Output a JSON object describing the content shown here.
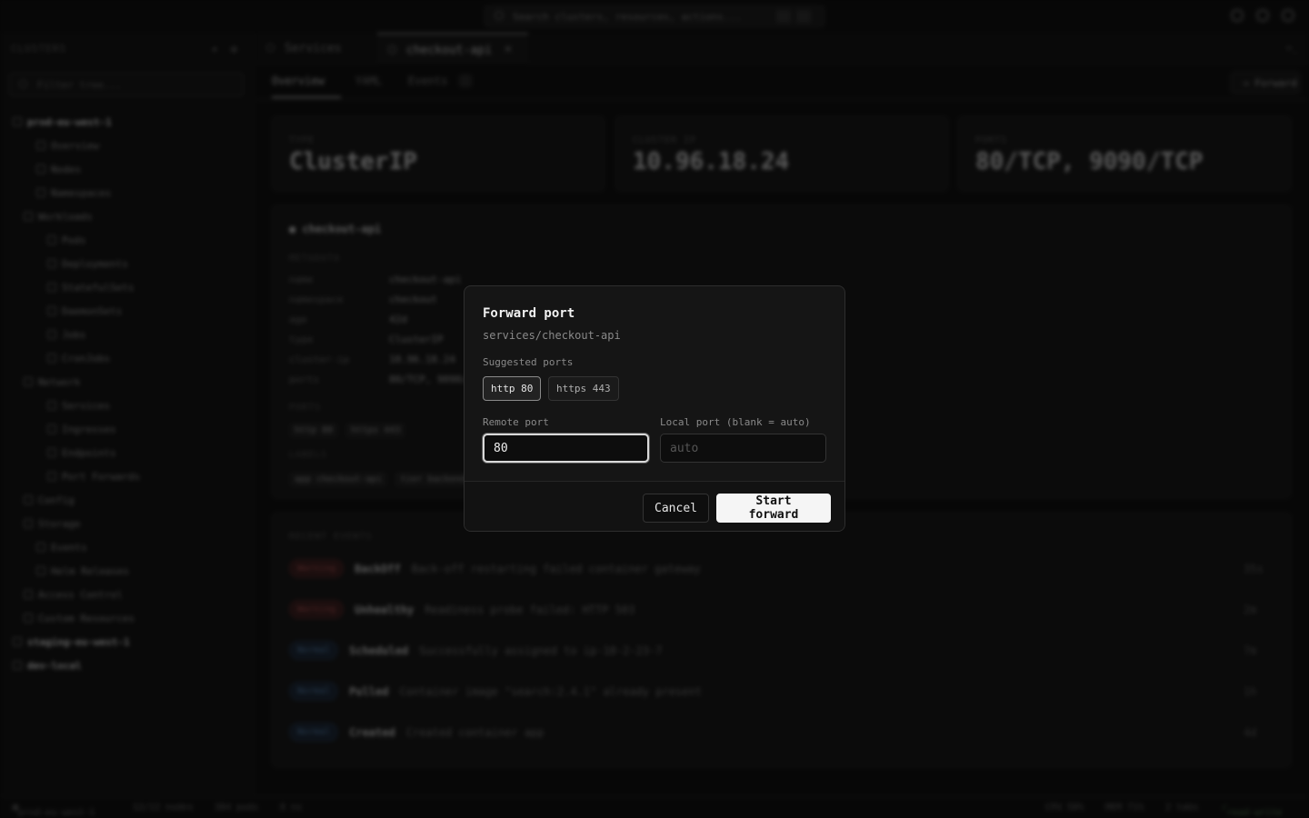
{
  "topbar": {
    "search_placeholder": "Search clusters, resources, actions..."
  },
  "sidebar": {
    "heading": "CLUSTERS",
    "filter_placeholder": "Filter tree...",
    "items": [
      {
        "label": "prod-eu-west-1",
        "level": 0,
        "bold": true
      },
      {
        "label": "Overview",
        "level": 2
      },
      {
        "label": "Nodes",
        "level": 2
      },
      {
        "label": "Namespaces",
        "level": 2
      },
      {
        "label": "Workloads",
        "level": 1
      },
      {
        "label": "Pods",
        "level": 3
      },
      {
        "label": "Deployments",
        "level": 3
      },
      {
        "label": "StatefulSets",
        "level": 3
      },
      {
        "label": "DaemonSets",
        "level": 3
      },
      {
        "label": "Jobs",
        "level": 3
      },
      {
        "label": "CronJobs",
        "level": 3
      },
      {
        "label": "Network",
        "level": 1
      },
      {
        "label": "Services",
        "level": 3
      },
      {
        "label": "Ingresses",
        "level": 3
      },
      {
        "label": "Endpoints",
        "level": 3
      },
      {
        "label": "Port Forwards",
        "level": 3
      },
      {
        "label": "Config",
        "level": 1
      },
      {
        "label": "Storage",
        "level": 1
      },
      {
        "label": "Events",
        "level": 2
      },
      {
        "label": "Helm Releases",
        "level": 2
      },
      {
        "label": "Access Control",
        "level": 1
      },
      {
        "label": "Custom Resources",
        "level": 1
      },
      {
        "label": "staging-eu-west-1",
        "level": 0,
        "bold": true
      },
      {
        "label": "dev-local",
        "level": 0,
        "bold": true
      }
    ]
  },
  "tabs": [
    {
      "label": "Services"
    },
    {
      "label": "checkout-api",
      "active": true
    }
  ],
  "subtabs": [
    {
      "label": "Overview",
      "active": true
    },
    {
      "label": "YAML"
    },
    {
      "label": "Events"
    }
  ],
  "forward_label": "Forward",
  "stats": [
    {
      "label": "TYPE",
      "value": "ClusterIP"
    },
    {
      "label": "CLUSTER IP",
      "value": "10.96.18.24"
    },
    {
      "label": "PORTS",
      "value": "80/TCP, 9090/TCP"
    }
  ],
  "detail": {
    "title": "checkout-api",
    "metadata_label": "METADATA",
    "rows": [
      {
        "k": "name",
        "v": "checkout-api"
      },
      {
        "k": "namespace",
        "v": "checkout"
      },
      {
        "k": "age",
        "v": "42d"
      },
      {
        "k": "type",
        "v": "ClusterIP"
      },
      {
        "k": "cluster-ip",
        "v": "10.96.18.24"
      },
      {
        "k": "ports",
        "v": "80/TCP, 9090/TCP"
      }
    ],
    "ports_label": "PORTS",
    "port_chips": [
      "http 80",
      "https 443"
    ],
    "labels_label": "LABELS",
    "label_chips": [
      "app checkout-api",
      "tier backend"
    ]
  },
  "events": {
    "heading": "RECENT EVENTS",
    "items": [
      {
        "type": "Warning",
        "reason": "BackOff",
        "message": "Back-off restarting failed container gateway",
        "age": "35s"
      },
      {
        "type": "Warning",
        "reason": "Unhealthy",
        "message": "Readiness probe failed: HTTP 503",
        "age": "2m"
      },
      {
        "type": "Normal",
        "reason": "Scheduled",
        "message": "Successfully assigned to ip-10-2-23-7",
        "age": "7m"
      },
      {
        "type": "Normal",
        "reason": "Pulled",
        "message": "Container image \"search:2.4.1\" already present",
        "age": "1h"
      },
      {
        "type": "Normal",
        "reason": "Created",
        "message": "Created container app",
        "age": "4d"
      }
    ]
  },
  "statusbar": {
    "cluster": "prod-eu-west-1",
    "nodes": "12/12 nodes",
    "pods": "384 pods",
    "ns": "8 ns",
    "cpu": "CPU 58%",
    "mem": "MEM 71%",
    "tabs": "2 tabs",
    "mode": "read-write"
  },
  "modal": {
    "title": "Forward port",
    "subtitle": "services/checkout-api",
    "suggested_label": "Suggested ports",
    "suggested": [
      "http 80",
      "https 443"
    ],
    "remote_label": "Remote port",
    "remote_value": "80",
    "local_label": "Local port (blank = auto)",
    "local_placeholder": "auto",
    "cancel_label": "Cancel",
    "start_label": "Start forward"
  }
}
